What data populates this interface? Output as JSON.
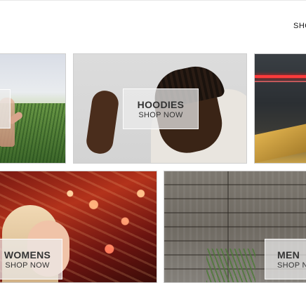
{
  "header": {
    "shop_label": "SHO"
  },
  "tiles": {
    "hoodies": {
      "title": "HOODIES",
      "cta": "SHOP NOW"
    },
    "womens": {
      "title": "WOMENS",
      "cta": "SHOP NOW"
    },
    "mens": {
      "title": "MEN",
      "cta": "SHOP NO"
    }
  },
  "colors": {
    "overlay": "#ebebeb",
    "text": "#333333"
  }
}
